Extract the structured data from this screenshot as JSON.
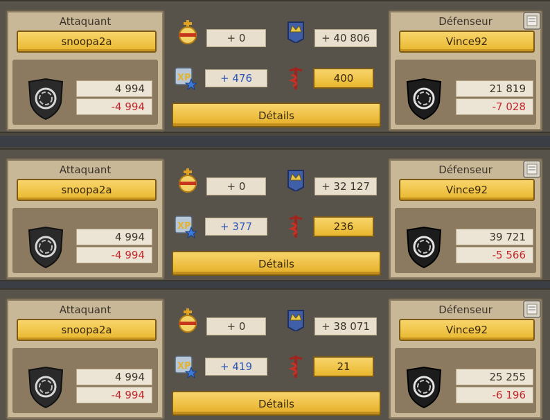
{
  "labels": {
    "attacker": "Attaquant",
    "defender": "Défenseur",
    "details": "Détails"
  },
  "reports": [
    {
      "attacker": {
        "name": "snoopa2a",
        "value": "4 994",
        "loss": "-4 994"
      },
      "defender": {
        "name": "Vince92",
        "value": "21 819",
        "loss": "-7 028"
      },
      "orb": "+ 0",
      "xp": "+ 476",
      "crown": "+ 40 806",
      "heal": "400"
    },
    {
      "attacker": {
        "name": "snoopa2a",
        "value": "4 994",
        "loss": "-4 994"
      },
      "defender": {
        "name": "Vince92",
        "value": "39 721",
        "loss": "-5 566"
      },
      "orb": "+ 0",
      "xp": "+ 377",
      "crown": "+ 32 127",
      "heal": "236"
    },
    {
      "attacker": {
        "name": "snoopa2a",
        "value": "4 994",
        "loss": "-4 994"
      },
      "defender": {
        "name": "Vince92",
        "value": "25 255",
        "loss": "-6 196"
      },
      "orb": "+ 0",
      "xp": "+ 419",
      "crown": "+ 38 071",
      "heal": "21"
    }
  ],
  "icons": {
    "orb": "golden-orb-icon",
    "xp": "xp-star-icon",
    "crown": "crown-banner-icon",
    "heal": "caduceus-icon",
    "shield": "shield-emblem-icon",
    "scroll": "scroll-icon"
  },
  "colors": {
    "gold_button": "#f1c548",
    "loss_red": "#c3262c",
    "xp_blue": "#2c55b8",
    "panel": "#c9b897",
    "background": "#57534b"
  }
}
